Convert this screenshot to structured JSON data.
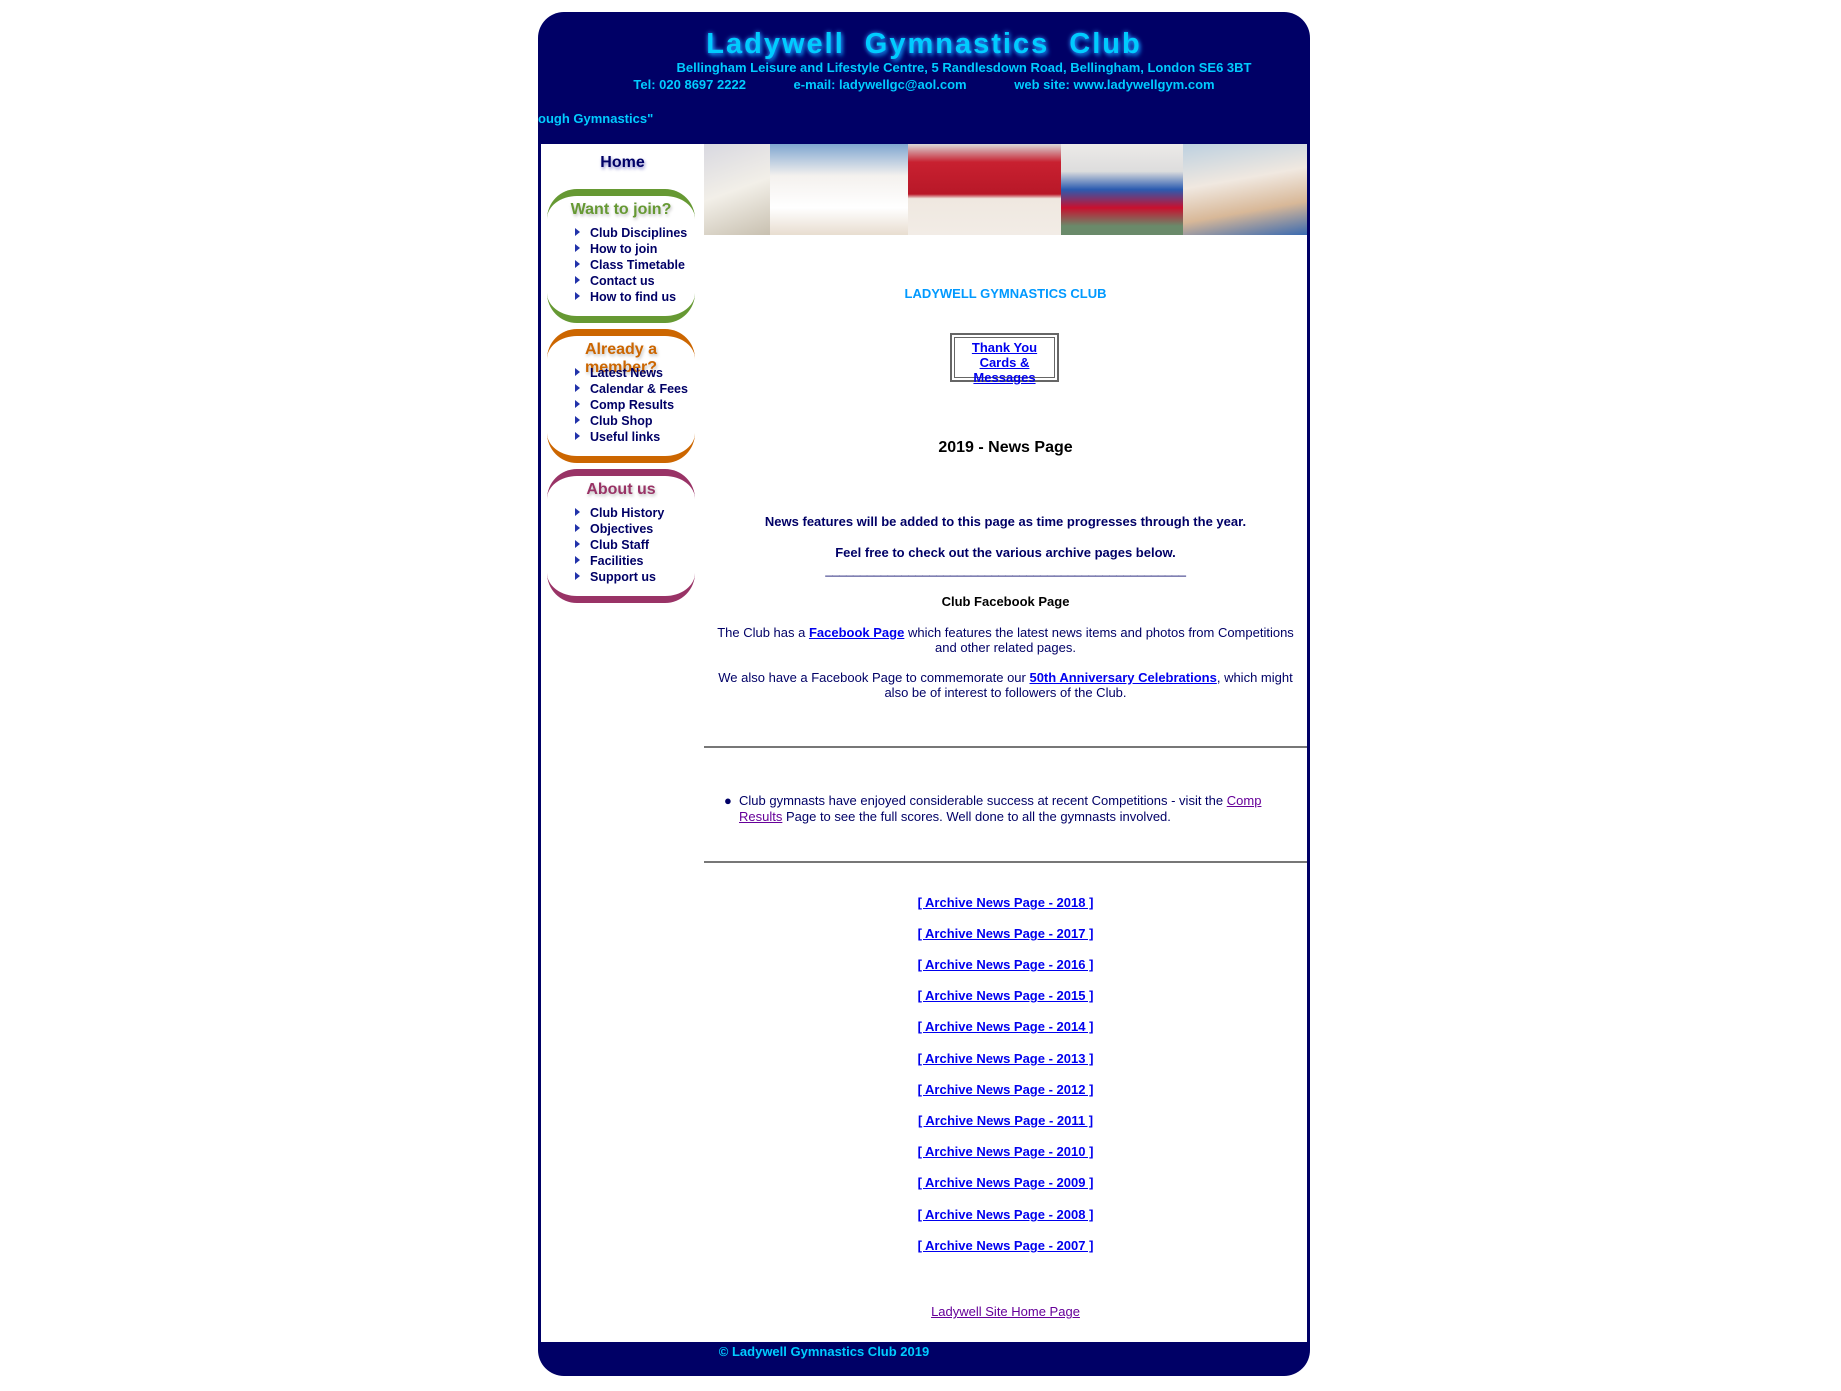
{
  "header": {
    "title": "Ladywell  Gymnastics  Club",
    "address": "Bellingham Leisure and Lifestyle Centre, 5 Randlesdown Road, Bellingham, London SE6 3BT",
    "tel": "Tel: 020 8697 2222",
    "email": "e-mail: ladywellgc@aol.com",
    "website": "web site: www.ladywellgym.com",
    "tagline": "ough Gymnastics\""
  },
  "sidebar": {
    "home": "Home",
    "sections": [
      {
        "title": "Want to join?",
        "items": [
          "Club Disciplines",
          "How to join",
          "Class Timetable",
          "Contact us",
          "How to find us"
        ]
      },
      {
        "title": "Already a member?",
        "items": [
          "Latest News",
          "Calendar & Fees",
          "Comp Results",
          "Club Shop",
          "Useful links"
        ]
      },
      {
        "title": "About  us",
        "items": [
          "Club History",
          "Objectives",
          "Club Staff",
          "Facilities",
          "Support us"
        ]
      }
    ]
  },
  "main": {
    "club_heading": "LADYWELL GYMNASTICS CLUB",
    "thank_you_link": "Thank You Cards & Messages",
    "page_title": "2019 -  News Page",
    "intro1": "News features will be added to this page as time progresses through the year.",
    "intro2": "Feel free to check out the various archive pages below.",
    "divider": "____________________________________________________",
    "facebook_heading": "Club Facebook Page",
    "fb_p1_pre": "The Club has a ",
    "fb_p1_link": "Facebook Page",
    "fb_p1_post": " which features the latest news items and photos from Competitions and other related pages.",
    "fb_p2_pre": "We also have a Facebook Page to commemorate our ",
    "fb_p2_link": "50th Anniversary Celebrations",
    "fb_p2_post": ", which might also be of interest to followers of the Club.",
    "bullet_pre": "Club gymnasts have enjoyed considerable success at recent Competitions - visit the ",
    "bullet_link": "Comp Results",
    "bullet_post": " Page to see the full scores. Well done to all the gymnasts involved.",
    "archives": [
      "[ Archive News Page - 2018 ]",
      "[ Archive News Page - 2017 ]",
      "[ Archive News Page - 2016 ]",
      "[ Archive News Page - 2015 ]",
      "[ Archive News Page - 2014 ]",
      "[ Archive News Page - 2013 ]",
      "[ Archive News Page - 2012 ]",
      "[ Archive News Page - 2011 ]",
      "[ Archive News Page - 2010 ]",
      "[ Archive News Page - 2009 ]",
      "[ Archive News Page - 2008 ]",
      "[ Archive News Page - 2007 ]"
    ],
    "home_link": "Ladywell Site Home Page"
  },
  "footer": {
    "copyright": "© Ladywell Gymnastics Club 2019"
  },
  "colors": {
    "navy": "#000066",
    "cyan": "#00ccff",
    "green": "#669933",
    "orange": "#cc6600",
    "purple": "#993366",
    "link": "#0000ee"
  }
}
